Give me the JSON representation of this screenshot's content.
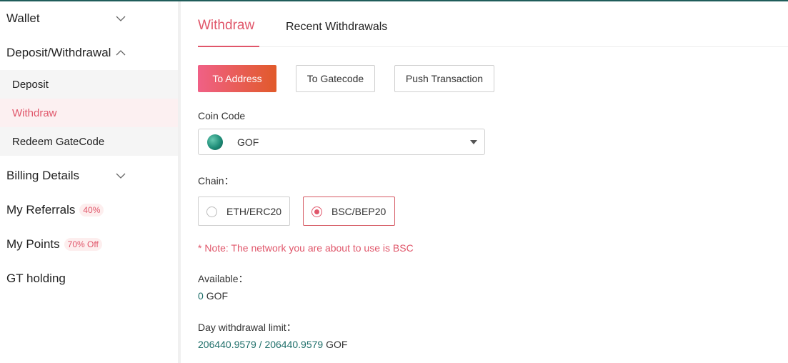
{
  "sidebar": {
    "wallet": "Wallet",
    "deposit_withdrawal": "Deposit/Withdrawal",
    "sub_items": [
      "Deposit",
      "Withdraw",
      "Redeem GateCode"
    ],
    "billing_details": "Billing Details",
    "my_referrals": "My Referrals",
    "my_referrals_badge": "40%",
    "my_points": "My Points",
    "my_points_badge": "70% Off",
    "gt_holding": "GT holding"
  },
  "tabs": {
    "withdraw": "Withdraw",
    "recent": "Recent Withdrawals"
  },
  "methods": {
    "to_address": "To Address",
    "to_gatecode": "To Gatecode",
    "push_transaction": "Push Transaction"
  },
  "coin": {
    "label": "Coin Code",
    "value": "GOF",
    "icon": "gof-coin-icon"
  },
  "chain": {
    "label": "Chain：",
    "options": [
      "ETH/ERC20",
      "BSC/BEP20"
    ],
    "selected": "BSC/BEP20"
  },
  "note": "* Note: The network you are about to use is BSC",
  "available": {
    "label": "Available：",
    "amount": "0",
    "unit": "GOF"
  },
  "limit": {
    "label": "Day withdrawal limit：",
    "used": "206440.9579",
    "sep": " / ",
    "total": "206440.9579",
    "unit": "GOF"
  },
  "colors": {
    "accent": "#e0566a",
    "teal": "#1f6f6a"
  }
}
